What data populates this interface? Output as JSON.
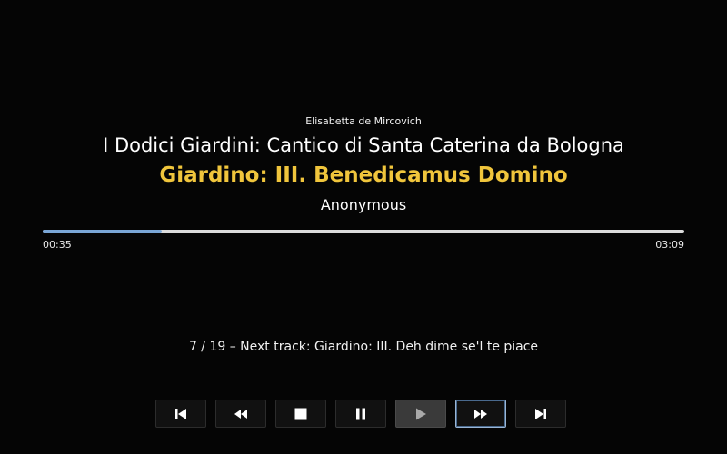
{
  "now_playing": {
    "artist": "Elisabetta de Mircovich",
    "album": "I Dodici Giardini: Cantico di Santa Caterina da Bologna",
    "track_title": "Giardino: III. Benedicamus Domino",
    "composer": "Anonymous"
  },
  "progress": {
    "elapsed": "00:35",
    "total": "03:09",
    "fraction": 0.185
  },
  "queue": {
    "next_info": "7 / 19 – Next track: Giardino: III. Deh dime se'l te piace"
  },
  "controls": [
    {
      "name": "previous-track-button",
      "icon": "skip-back-icon",
      "enabled": true
    },
    {
      "name": "rewind-button",
      "icon": "rewind-icon",
      "enabled": true
    },
    {
      "name": "stop-button",
      "icon": "stop-icon",
      "enabled": true
    },
    {
      "name": "pause-button",
      "icon": "pause-icon",
      "enabled": true
    },
    {
      "name": "play-button",
      "icon": "play-icon",
      "enabled": false
    },
    {
      "name": "fast-forward-button",
      "icon": "fast-forward-icon",
      "enabled": true,
      "focused": true
    },
    {
      "name": "next-track-button",
      "icon": "skip-forward-icon",
      "enabled": true
    }
  ],
  "colors": {
    "background": "#050505",
    "title_accent": "#f0c53c",
    "progress_fill": "#7aa6d6",
    "progress_track": "#dcdcdc"
  }
}
